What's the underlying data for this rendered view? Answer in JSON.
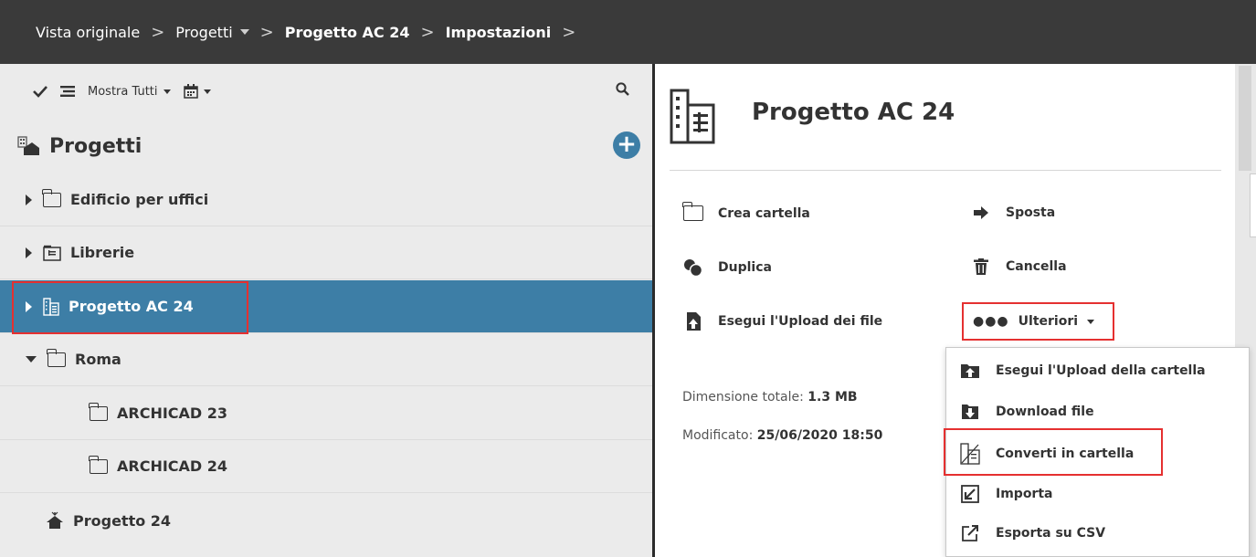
{
  "breadcrumb": {
    "items": [
      "Vista originale",
      "Progetti",
      "Progetto AC 24",
      "Impostazioni"
    ]
  },
  "toolbar": {
    "filter_label": "Mostra Tutti"
  },
  "tree": {
    "header": "Progetti",
    "rows": [
      {
        "label": "Edificio per uffici"
      },
      {
        "label": "Librerie"
      },
      {
        "label": "Progetto AC 24"
      },
      {
        "label": "Roma"
      },
      {
        "label": "ARCHICAD 23"
      },
      {
        "label": "ARCHICAD 24"
      },
      {
        "label": "Progetto 24"
      }
    ]
  },
  "detail": {
    "title": "Progetto AC 24",
    "actions": {
      "create_folder": "Crea cartella",
      "move": "Sposta",
      "duplicate": "Duplica",
      "delete": "Cancella",
      "upload_files": "Esegui l'Upload dei file",
      "more": "Ulteriori"
    },
    "size_label": "Dimensione totale:",
    "size_value": "1.3 MB",
    "modified_label": "Modificato:",
    "modified_value": "25/06/2020 18:50"
  },
  "menu": {
    "items": [
      {
        "label": "Esegui l'Upload della cartella"
      },
      {
        "label": "Download file"
      },
      {
        "label": "Converti in cartella"
      },
      {
        "label": "Importa"
      },
      {
        "label": "Esporta su CSV"
      }
    ]
  },
  "colors": {
    "topbar": "#3a3a3a",
    "selected_row": "#3d7ea6",
    "highlight": "#e53030"
  }
}
